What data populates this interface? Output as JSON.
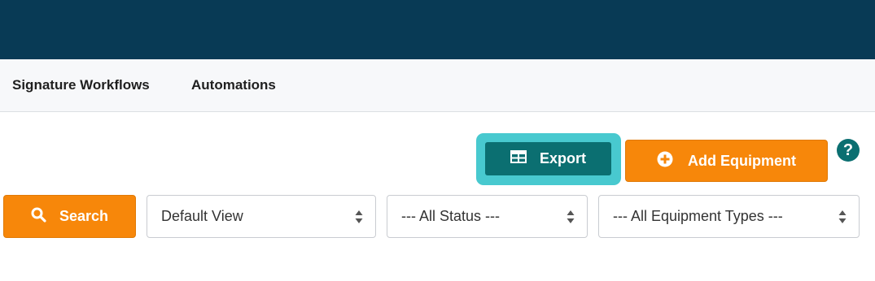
{
  "subnav": {
    "items": [
      {
        "label": "Signature Workflows"
      },
      {
        "label": "Automations"
      }
    ]
  },
  "toolbar": {
    "export_label": "Export",
    "add_label": "Add Equipment",
    "help_label": "?"
  },
  "filters": {
    "search_label": "Search",
    "view_select": "Default View",
    "status_select": "--- All Status ---",
    "type_select": "--- All Equipment Types ---"
  },
  "colors": {
    "header": "#083a55",
    "accent_orange": "#f7870a",
    "accent_teal": "#0b6f71",
    "highlight": "#48c9cf"
  }
}
